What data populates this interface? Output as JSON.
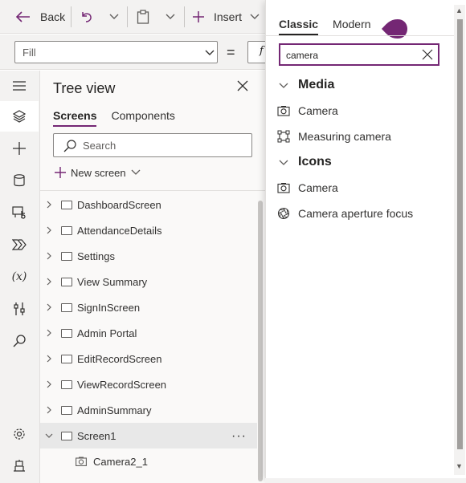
{
  "toolbar": {
    "back_label": "Back",
    "insert_label": "Insert"
  },
  "formula": {
    "property": "Fill",
    "equals": "=",
    "fx": "f"
  },
  "tree": {
    "title": "Tree view",
    "tabs": [
      "Screens",
      "Components"
    ],
    "search_placeholder": "Search",
    "new_screen_label": "New screen",
    "rows": [
      {
        "label": "DashboardScreen"
      },
      {
        "label": "AttendanceDetails"
      },
      {
        "label": "Settings"
      },
      {
        "label": "View Summary"
      },
      {
        "label": "SignInScreen"
      },
      {
        "label": "Admin Portal"
      },
      {
        "label": "EditRecordScreen"
      },
      {
        "label": "ViewRecordScreen"
      },
      {
        "label": "AdminSummary"
      },
      {
        "label": "Screen1"
      }
    ],
    "selected_more": "···",
    "child": {
      "label": "Camera2_1"
    }
  },
  "flyout": {
    "tabs": [
      "Classic",
      "Modern"
    ],
    "search_value": "camera",
    "categories": [
      {
        "name": "Media",
        "items": [
          "Camera",
          "Measuring camera"
        ]
      },
      {
        "name": "Icons",
        "items": [
          "Camera",
          "Camera aperture focus"
        ]
      }
    ]
  },
  "colors": {
    "accent": "#742774",
    "rail_bg": "#f3f2f1",
    "panel_bg": "#faf9f8"
  }
}
